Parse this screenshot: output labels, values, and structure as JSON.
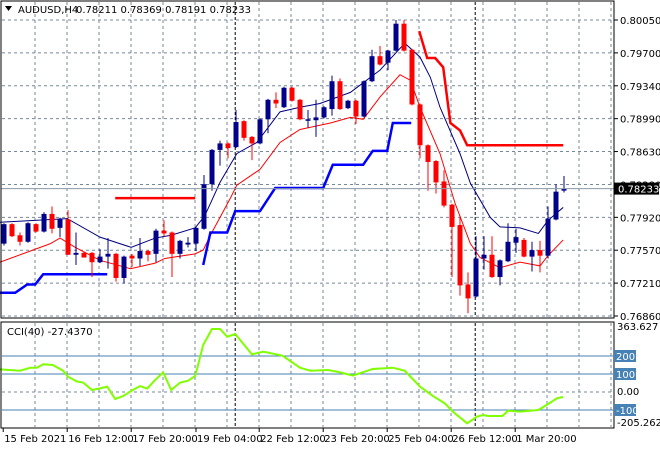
{
  "header": {
    "symbol": "AUDUSD,H4",
    "ohlc": "0.78211 0.78369 0.78191 0.78233",
    "menu_icon": "triangle-down-icon"
  },
  "colors": {
    "bull": "#00008b",
    "bear": "#ff0000",
    "ma_fast": "#000080",
    "ma_slow": "#ff0000",
    "support": "#0000ff",
    "resistance": "#ff0000",
    "cci": "#7fff00",
    "cci_levels": "#4682b4",
    "grid": "#778899"
  },
  "price_axis": {
    "labels": [
      "0.80050",
      "0.79700",
      "0.79340",
      "0.78990",
      "0.78630",
      "0.78280",
      "0.77920",
      "0.77570",
      "0.77210",
      "0.76860"
    ],
    "current": "0.78233",
    "range": [
      0.7686,
      0.8005
    ]
  },
  "cci_panel": {
    "title": "CCI(40) -27.4370",
    "max_label": "363.627",
    "min_label": "-205.2621",
    "zero_label": "0.00",
    "levels": [
      {
        "value": 200,
        "label": "200"
      },
      {
        "value": 100,
        "label": "100"
      },
      {
        "value": -100,
        "label": "-100"
      }
    ],
    "range": [
      -205.2621,
      363.627
    ],
    "points": [
      [
        0.5,
        126
      ],
      [
        3,
        118
      ],
      [
        4.3,
        135
      ],
      [
        5.1,
        135
      ],
      [
        5.9,
        154
      ],
      [
        7.1,
        150
      ],
      [
        8.4,
        118
      ],
      [
        9,
        85
      ],
      [
        10.1,
        59
      ],
      [
        10.9,
        52
      ],
      [
        12,
        11
      ],
      [
        13,
        20
      ],
      [
        13.9,
        30
      ],
      [
        14.9,
        -39
      ],
      [
        15.9,
        -22
      ],
      [
        17.1,
        11
      ],
      [
        18,
        33
      ],
      [
        18.9,
        19
      ],
      [
        19.9,
        67
      ],
      [
        20.9,
        109
      ],
      [
        21.9,
        11
      ],
      [
        23,
        52
      ],
      [
        24,
        63
      ],
      [
        24.9,
        89
      ],
      [
        25.9,
        261
      ],
      [
        27,
        350
      ],
      [
        28,
        350
      ],
      [
        28.9,
        307
      ],
      [
        29.9,
        322
      ],
      [
        32,
        209
      ],
      [
        33.4,
        224
      ],
      [
        35.8,
        202
      ],
      [
        38,
        135
      ],
      [
        39.3,
        118
      ],
      [
        41.5,
        122
      ],
      [
        43,
        109
      ],
      [
        44.6,
        91
      ],
      [
        47.1,
        128
      ],
      [
        49.6,
        135
      ],
      [
        51.1,
        118
      ],
      [
        53,
        30
      ],
      [
        54.6,
        -22
      ],
      [
        56.1,
        -63
      ],
      [
        57.1,
        -109
      ],
      [
        58.9,
        -174
      ],
      [
        60.1,
        -137
      ],
      [
        60.9,
        -128
      ],
      [
        61.5,
        -133
      ],
      [
        63.3,
        -133
      ],
      [
        64,
        -104
      ],
      [
        65.5,
        -109
      ],
      [
        67.8,
        -100
      ],
      [
        69.3,
        -59
      ],
      [
        70.1,
        -35
      ],
      [
        70.9,
        -27
      ]
    ]
  },
  "time_axis": {
    "labels": [
      {
        "text": "15 Feb 2021",
        "bar": 0.9
      },
      {
        "text": "16 Feb 12:00",
        "bar": 8.9
      },
      {
        "text": "17 Feb 20:00",
        "bar": 16.9
      },
      {
        "text": "19 Feb 04:00",
        "bar": 25
      },
      {
        "text": "22 Feb 12:00",
        "bar": 32.9
      },
      {
        "text": "23 Feb 20:00",
        "bar": 40.9
      },
      {
        "text": "25 Feb 04:00",
        "bar": 48.9
      },
      {
        "text": "26 Feb 12:00",
        "bar": 56.9
      },
      {
        "text": "1 Mar 20:00",
        "bar": 64.9
      }
    ],
    "separators": [
      29.9,
      59.9
    ]
  },
  "candles": [
    [
      0.7764,
      0.7786,
      0.7762,
      0.7785
    ],
    [
      0.7785,
      0.7786,
      0.7771,
      0.7772
    ],
    [
      0.7773,
      0.7776,
      0.7762,
      0.7766
    ],
    [
      0.7766,
      0.7787,
      0.7765,
      0.7786
    ],
    [
      0.7785,
      0.7786,
      0.7776,
      0.7777
    ],
    [
      0.7777,
      0.7798,
      0.7776,
      0.7796
    ],
    [
      0.7796,
      0.7804,
      0.7775,
      0.778
    ],
    [
      0.7781,
      0.7792,
      0.7771,
      0.779
    ],
    [
      0.779,
      0.78,
      0.7752,
      0.7752
    ],
    [
      0.7752,
      0.7776,
      0.7741,
      0.7754
    ],
    [
      0.7754,
      0.7755,
      0.7749,
      0.7749
    ],
    [
      0.7754,
      0.7755,
      0.7728,
      0.7744
    ],
    [
      0.7744,
      0.7758,
      0.7743,
      0.775
    ],
    [
      0.775,
      0.777,
      0.7737,
      0.7753
    ],
    [
      0.7753,
      0.7754,
      0.7723,
      0.7727
    ],
    [
      0.7727,
      0.7751,
      0.7721,
      0.775
    ],
    [
      0.7751,
      0.7753,
      0.7739,
      0.7748
    ],
    [
      0.7748,
      0.777,
      0.774,
      0.7756
    ],
    [
      0.7756,
      0.7757,
      0.7745,
      0.7752
    ],
    [
      0.7753,
      0.778,
      0.7744,
      0.7778
    ],
    [
      0.7778,
      0.7789,
      0.7772,
      0.7775
    ],
    [
      0.7776,
      0.7777,
      0.7728,
      0.7753
    ],
    [
      0.7753,
      0.7768,
      0.7748,
      0.7767
    ],
    [
      0.7763,
      0.7771,
      0.776,
      0.7765
    ],
    [
      0.7764,
      0.7782,
      0.7756,
      0.7781
    ],
    [
      0.778,
      0.7838,
      0.7779,
      0.7828
    ],
    [
      0.7828,
      0.7866,
      0.7821,
      0.7865
    ],
    [
      0.7865,
      0.7875,
      0.7848,
      0.7872
    ],
    [
      0.7872,
      0.7873,
      0.7856,
      0.7867
    ],
    [
      0.7868,
      0.7908,
      0.7867,
      0.7895
    ],
    [
      0.7896,
      0.7897,
      0.7875,
      0.7878
    ],
    [
      0.7879,
      0.788,
      0.7854,
      0.7872
    ],
    [
      0.7872,
      0.7899,
      0.7871,
      0.7898
    ],
    [
      0.7898,
      0.792,
      0.7883,
      0.7919
    ],
    [
      0.7919,
      0.7927,
      0.791,
      0.7915
    ],
    [
      0.7911,
      0.7933,
      0.791,
      0.7932
    ],
    [
      0.7932,
      0.7933,
      0.7917,
      0.7918
    ],
    [
      0.7919,
      0.792,
      0.7897,
      0.7898
    ],
    [
      0.7897,
      0.7908,
      0.7889,
      0.7898
    ],
    [
      0.7897,
      0.7919,
      0.7879,
      0.79
    ],
    [
      0.79,
      0.7912,
      0.7899,
      0.7911
    ],
    [
      0.7909,
      0.7945,
      0.7902,
      0.7939
    ],
    [
      0.7939,
      0.7942,
      0.7908,
      0.7909
    ],
    [
      0.791,
      0.7919,
      0.7909,
      0.7918
    ],
    [
      0.7918,
      0.7919,
      0.7893,
      0.7901
    ],
    [
      0.7901,
      0.794,
      0.79,
      0.7939
    ],
    [
      0.7939,
      0.7973,
      0.7938,
      0.7966
    ],
    [
      0.7966,
      0.7977,
      0.7956,
      0.7957
    ],
    [
      0.7959,
      0.7973,
      0.7951,
      0.7972
    ],
    [
      0.7972,
      0.8005,
      0.7971,
      0.8001
    ],
    [
      0.8001,
      0.8005,
      0.7971,
      0.7972
    ],
    [
      0.7973,
      0.7974,
      0.7913,
      0.7914
    ],
    [
      0.7914,
      0.7915,
      0.7856,
      0.787
    ],
    [
      0.787,
      0.7871,
      0.7821,
      0.7852
    ],
    [
      0.7853,
      0.7854,
      0.7818,
      0.783
    ],
    [
      0.7831,
      0.7843,
      0.7803,
      0.7805
    ],
    [
      0.7806,
      0.7807,
      0.7728,
      0.7782
    ],
    [
      0.7784,
      0.7794,
      0.7708,
      0.7719
    ],
    [
      0.772,
      0.7733,
      0.7689,
      0.7705
    ],
    [
      0.7707,
      0.7772,
      0.7706,
      0.7748
    ],
    [
      0.7748,
      0.7772,
      0.7736,
      0.7752
    ],
    [
      0.7752,
      0.7772,
      0.7727,
      0.7728
    ],
    [
      0.7728,
      0.7747,
      0.7719,
      0.7746
    ],
    [
      0.7745,
      0.7786,
      0.7744,
      0.7766
    ],
    [
      0.7765,
      0.778,
      0.7754,
      0.7771
    ],
    [
      0.7768,
      0.777,
      0.7749,
      0.775
    ],
    [
      0.775,
      0.7766,
      0.7734,
      0.7757
    ],
    [
      0.7757,
      0.7767,
      0.7733,
      0.7751
    ],
    [
      0.7751,
      0.7804,
      0.7748,
      0.7791
    ],
    [
      0.779,
      0.7828,
      0.7789,
      0.782
    ],
    [
      0.78211,
      0.78369,
      0.78191,
      0.78233
    ]
  ],
  "indicators": {
    "ma_fast": [
      [
        0.5,
        0.7787
      ],
      [
        8.9,
        0.7791
      ],
      [
        13,
        0.7771
      ],
      [
        16.9,
        0.776
      ],
      [
        19.9,
        0.777
      ],
      [
        21.9,
        0.7773
      ],
      [
        24.9,
        0.7781
      ],
      [
        26.1,
        0.7794
      ],
      [
        28,
        0.783
      ],
      [
        30.1,
        0.7861
      ],
      [
        32.6,
        0.7873
      ],
      [
        35.5,
        0.7906
      ],
      [
        38,
        0.7911
      ],
      [
        40.5,
        0.7915
      ],
      [
        44.3,
        0.7927
      ],
      [
        48,
        0.7951
      ],
      [
        51.1,
        0.798
      ],
      [
        53,
        0.7965
      ],
      [
        54.3,
        0.7943
      ],
      [
        55.5,
        0.7911
      ],
      [
        58,
        0.7861
      ],
      [
        59.3,
        0.7829
      ],
      [
        61.8,
        0.7792
      ],
      [
        63,
        0.7782
      ],
      [
        65.5,
        0.7781
      ],
      [
        67.8,
        0.7775
      ],
      [
        69,
        0.7789
      ],
      [
        70.9,
        0.7803
      ]
    ],
    "ma_slow": [
      [
        0.5,
        0.7744
      ],
      [
        6.8,
        0.7764
      ],
      [
        8,
        0.777
      ],
      [
        9.9,
        0.776
      ],
      [
        13,
        0.7746
      ],
      [
        16.8,
        0.7737
      ],
      [
        19.9,
        0.7743
      ],
      [
        21.1,
        0.7748
      ],
      [
        24.9,
        0.7753
      ],
      [
        25.9,
        0.7757
      ],
      [
        26.8,
        0.7773
      ],
      [
        29.3,
        0.7813
      ],
      [
        30.1,
        0.7827
      ],
      [
        33,
        0.7844
      ],
      [
        35.5,
        0.7873
      ],
      [
        38,
        0.7887
      ],
      [
        41.8,
        0.7894
      ],
      [
        44.3,
        0.79
      ],
      [
        45.9,
        0.7898
      ],
      [
        48,
        0.7922
      ],
      [
        50.5,
        0.7946
      ],
      [
        51.8,
        0.794
      ],
      [
        53,
        0.7911
      ],
      [
        55.5,
        0.7861
      ],
      [
        57.4,
        0.7807
      ],
      [
        59.3,
        0.7764
      ],
      [
        60.5,
        0.7749
      ],
      [
        63,
        0.7738
      ],
      [
        65.5,
        0.7744
      ],
      [
        68,
        0.774
      ],
      [
        69,
        0.7751
      ],
      [
        70.9,
        0.7768
      ]
    ],
    "support": [
      [
        [
          0.5,
          0.7711
        ],
        [
          2.4,
          0.7711
        ],
        [
          3.9,
          0.772
        ],
        [
          4.9,
          0.772
        ],
        [
          5.9,
          0.7731
        ],
        [
          13.9,
          0.7731
        ]
      ],
      [
        [
          25.9,
          0.7741
        ],
        [
          26.8,
          0.7776
        ],
        [
          28.9,
          0.7776
        ],
        [
          29.9,
          0.7799
        ],
        [
          33,
          0.7799
        ],
        [
          34.9,
          0.7824
        ],
        [
          40.9,
          0.7824
        ],
        [
          42.1,
          0.7849
        ],
        [
          45.9,
          0.7849
        ],
        [
          47.1,
          0.7864
        ],
        [
          48.9,
          0.7864
        ],
        [
          49.6,
          0.7894
        ],
        [
          51.9,
          0.7894
        ]
      ]
    ],
    "resistance": [
      [
        [
          14.9,
          0.7813
        ],
        [
          24.9,
          0.7813
        ]
      ],
      [
        [
          52.9,
          0.7993
        ],
        [
          53.9,
          0.7964
        ],
        [
          54.9,
          0.7964
        ],
        [
          55.9,
          0.7954
        ],
        [
          56.8,
          0.7894
        ],
        [
          58,
          0.7886
        ],
        [
          58.9,
          0.787
        ],
        [
          70.9,
          0.787
        ]
      ]
    ]
  }
}
